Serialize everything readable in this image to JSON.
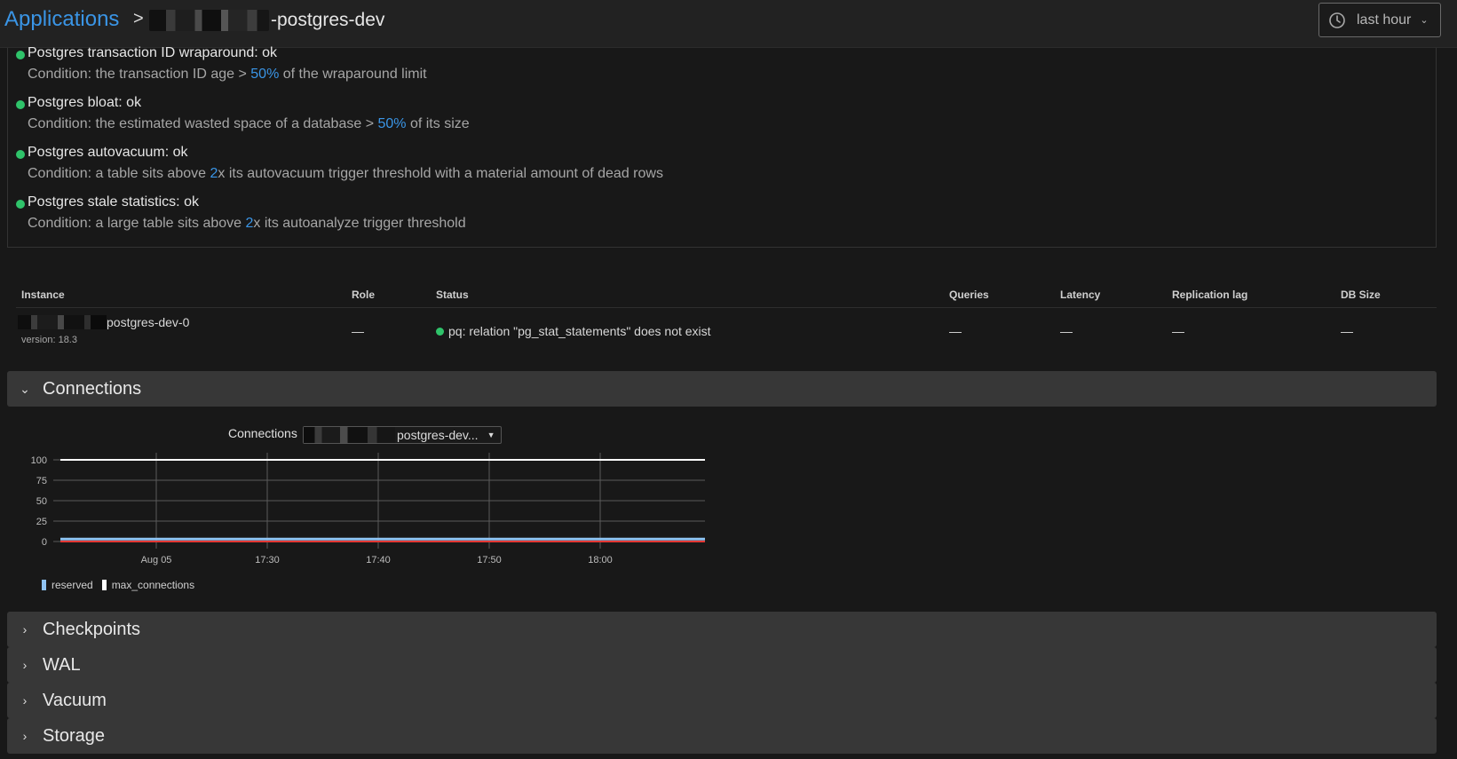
{
  "header": {
    "breadcrumb_root": "Applications",
    "breadcrumb_separator": ">",
    "app_name": "-postgres-dev",
    "time_range": "last hour"
  },
  "checks": [
    {
      "title": "Postgres transaction ID wraparound: ok",
      "cond_pre": "Condition: the transaction ID age > ",
      "cond_value": "50%",
      "cond_post": " of the wraparound limit"
    },
    {
      "title": "Postgres bloat: ok",
      "cond_pre": "Condition: the estimated wasted space of a database > ",
      "cond_value": "50%",
      "cond_post": " of its size"
    },
    {
      "title": "Postgres autovacuum: ok",
      "cond_pre": "Condition: a table sits above ",
      "cond_value": "2",
      "cond_post": "x its autovacuum trigger threshold with a material amount of dead rows"
    },
    {
      "title": "Postgres stale statistics: ok",
      "cond_pre": "Condition: a large table sits above ",
      "cond_value": "2",
      "cond_post": "x its autoanalyze trigger threshold"
    }
  ],
  "table": {
    "headers": {
      "instance": "Instance",
      "role": "Role",
      "status": "Status",
      "queries": "Queries",
      "latency": "Latency",
      "replication_lag": "Replication lag",
      "db_size": "DB Size"
    },
    "row": {
      "instance": "postgres-dev-0",
      "version": "version: 18.3",
      "role": "—",
      "status": "pq: relation \"pg_stat_statements\" does not exist",
      "status_color": "#2fc36a",
      "queries": "—",
      "latency": "—",
      "replication_lag": "—",
      "db_size": "—"
    }
  },
  "sections": {
    "connections": "Connections",
    "checkpoints": "Checkpoints",
    "wal": "WAL",
    "vacuum": "Vacuum",
    "storage": "Storage"
  },
  "chart": {
    "title": "Connections",
    "selected_instance": "postgres-dev..."
  },
  "chart_data": {
    "type": "line",
    "x_ticks": [
      "Aug 05",
      "17:30",
      "17:40",
      "17:50",
      "18:00"
    ],
    "y_ticks": [
      100,
      75,
      50,
      25,
      0
    ],
    "ylim": [
      0,
      100
    ],
    "grid": true,
    "legend_placement": "bottom-left",
    "series": [
      {
        "name": "reserved",
        "color": "#8fc3f2",
        "values": [
          3,
          3,
          3,
          3,
          3,
          3
        ]
      },
      {
        "name": "max_connections",
        "color": "#ffffff",
        "values": [
          100,
          100,
          100,
          100,
          100,
          100
        ]
      },
      {
        "color": "#e53935",
        "values": [
          0,
          0,
          0,
          0,
          0,
          0
        ]
      }
    ]
  },
  "colors": {
    "accent": "#3a95e6",
    "ok": "#2fc36a",
    "background": "#181818"
  }
}
